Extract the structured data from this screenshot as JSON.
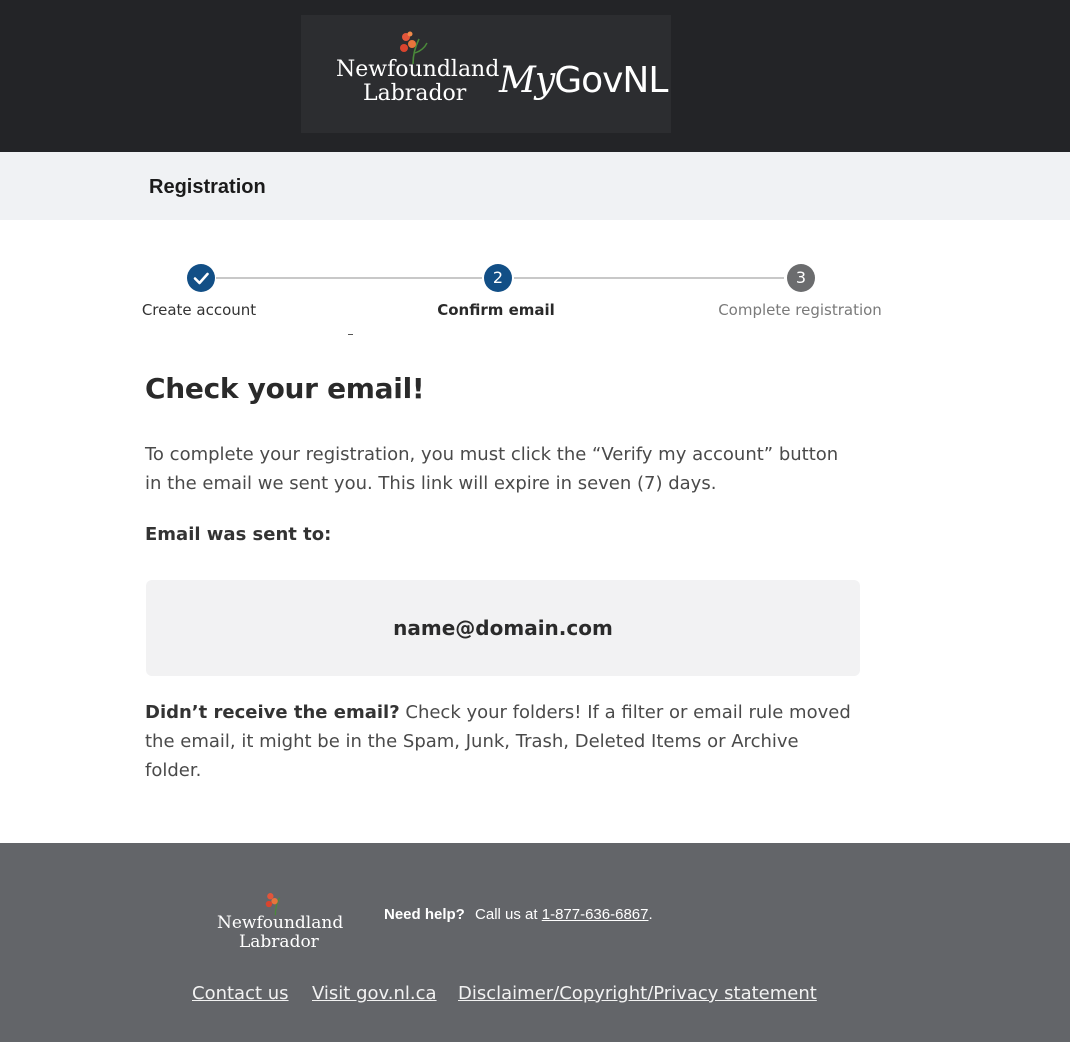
{
  "header": {
    "brand_line1": "Newfoundland",
    "brand_line2": "Labrador",
    "app_my": "My",
    "app_gov": "GovNL"
  },
  "subbar": {
    "title": "Registration"
  },
  "stepper": {
    "steps": [
      {
        "label": "Create account",
        "number": "",
        "state": "complete"
      },
      {
        "label": "Confirm email",
        "number": "2",
        "state": "current"
      },
      {
        "label": "Complete registration",
        "number": "3",
        "state": "upcoming"
      }
    ],
    "colors": {
      "complete": "#124f86",
      "current": "#124f86",
      "upcoming": "#6b6c6e"
    }
  },
  "main": {
    "heading": "Check your email!",
    "instructions": "To complete your registration, you must click the “Verify my account” button in the email we sent you. This link will expire in seven (7) days.",
    "sent_to_label": "Email was sent to:",
    "email": "name@domain.com",
    "didnt_receive_bold": "Didn’t receive the email?",
    "didnt_receive_text": " Check your folders! If a filter or email rule moved the email, it might be in the Spam, Junk, Trash, Deleted Items or Archive folder."
  },
  "footer": {
    "brand_line1": "Newfoundland",
    "brand_line2": "Labrador",
    "help_label": "Need help?",
    "call_text": "Call us at ",
    "phone": "1-877-636-6867",
    "period": ".",
    "links": [
      "Contact us",
      "Visit gov.nl.ca",
      "Disclaimer/Copyright/Privacy statement"
    ]
  }
}
